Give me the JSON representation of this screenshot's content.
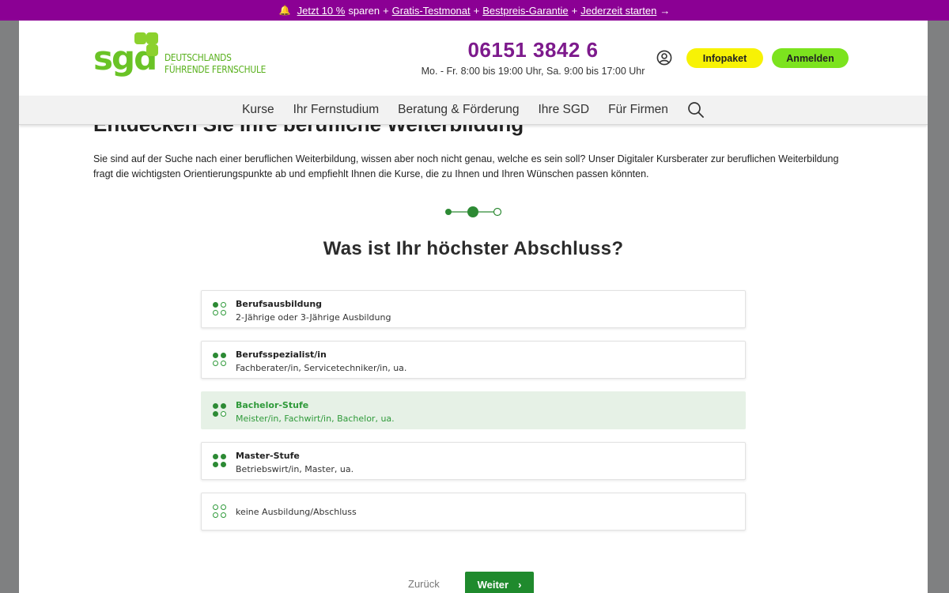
{
  "promo": {
    "bell_icon": "bell-icon",
    "discount_link": "Jetzt 10 %",
    "discount_suffix": "sparen",
    "plus1": "+",
    "trial_link": "Gratis-Testmonat",
    "plus2": "+",
    "price_link": "Bestpreis-Garantie",
    "plus3": "+",
    "start_link": "Jederzeit starten",
    "arrow": "→",
    "color": "#8b0094"
  },
  "header": {
    "logo_text": "sgd",
    "logo_tagline_1": "DEUTSCHLANDS",
    "logo_tagline_2": "FÜHRENDE FERNSCHULE",
    "phone": "06151 3842 6",
    "hours": "Mo. - Fr. 8:00 bis 19:00 Uhr, Sa. 9:00 bis 17:00 Uhr",
    "user_icon": "user-icon",
    "infopaket_label": "Infopaket",
    "anmelden_label": "Anmelden"
  },
  "nav": {
    "items": [
      "Kurse",
      "Ihr Fernstudium",
      "Beratung & Förderung",
      "Ihre SGD",
      "Für Firmen"
    ],
    "search_icon": "search-icon"
  },
  "main": {
    "heading": "Entdecken Sie Ihre berufliche Weiterbildung",
    "intro": "Sie sind auf der Suche nach einer beruflichen Weiterbildung, wissen aber noch nicht genau, welche es sein soll? Unser Digitaler Kursberater zur beruflichen Weiterbildung fragt die wichtigsten Orientierungspunkte ab und empfiehlt Ihnen die Kurse, die zu Ihnen und Ihren Wünschen passen könnten.",
    "stepper": {
      "total": 3,
      "current": 2
    },
    "question": "Was ist Ihr höchster Abschluss?",
    "options": [
      {
        "title": "Berufsausbildung",
        "subtitle": "2-Jährige oder 3-Jährige Ausbildung",
        "level": 1,
        "selected": false
      },
      {
        "title": "Berufsspezialist/in",
        "subtitle": "Fachberater/in, Servicetechniker/in, ua.",
        "level": 2,
        "selected": false
      },
      {
        "title": "Bachelor-Stufe",
        "subtitle": "Meister/in, Fachwirt/in, Bachelor, ua.",
        "level": 3,
        "selected": true
      },
      {
        "title": "Master-Stufe",
        "subtitle": "Betriebswirt/in, Master, ua.",
        "level": 4,
        "selected": false
      },
      {
        "title": "keine Ausbildung/Abschluss",
        "subtitle": "",
        "level": 0,
        "selected": false
      }
    ],
    "back_label": "Zurück",
    "next_label": "Weiter",
    "next_chevron": "›"
  },
  "colors": {
    "brand_green": "#6ac326",
    "accent_purple": "#7d1a8c",
    "button_green": "#1f8a2d",
    "infopaket_yellow": "#f7f205",
    "anmelden_green": "#7ce31e"
  }
}
